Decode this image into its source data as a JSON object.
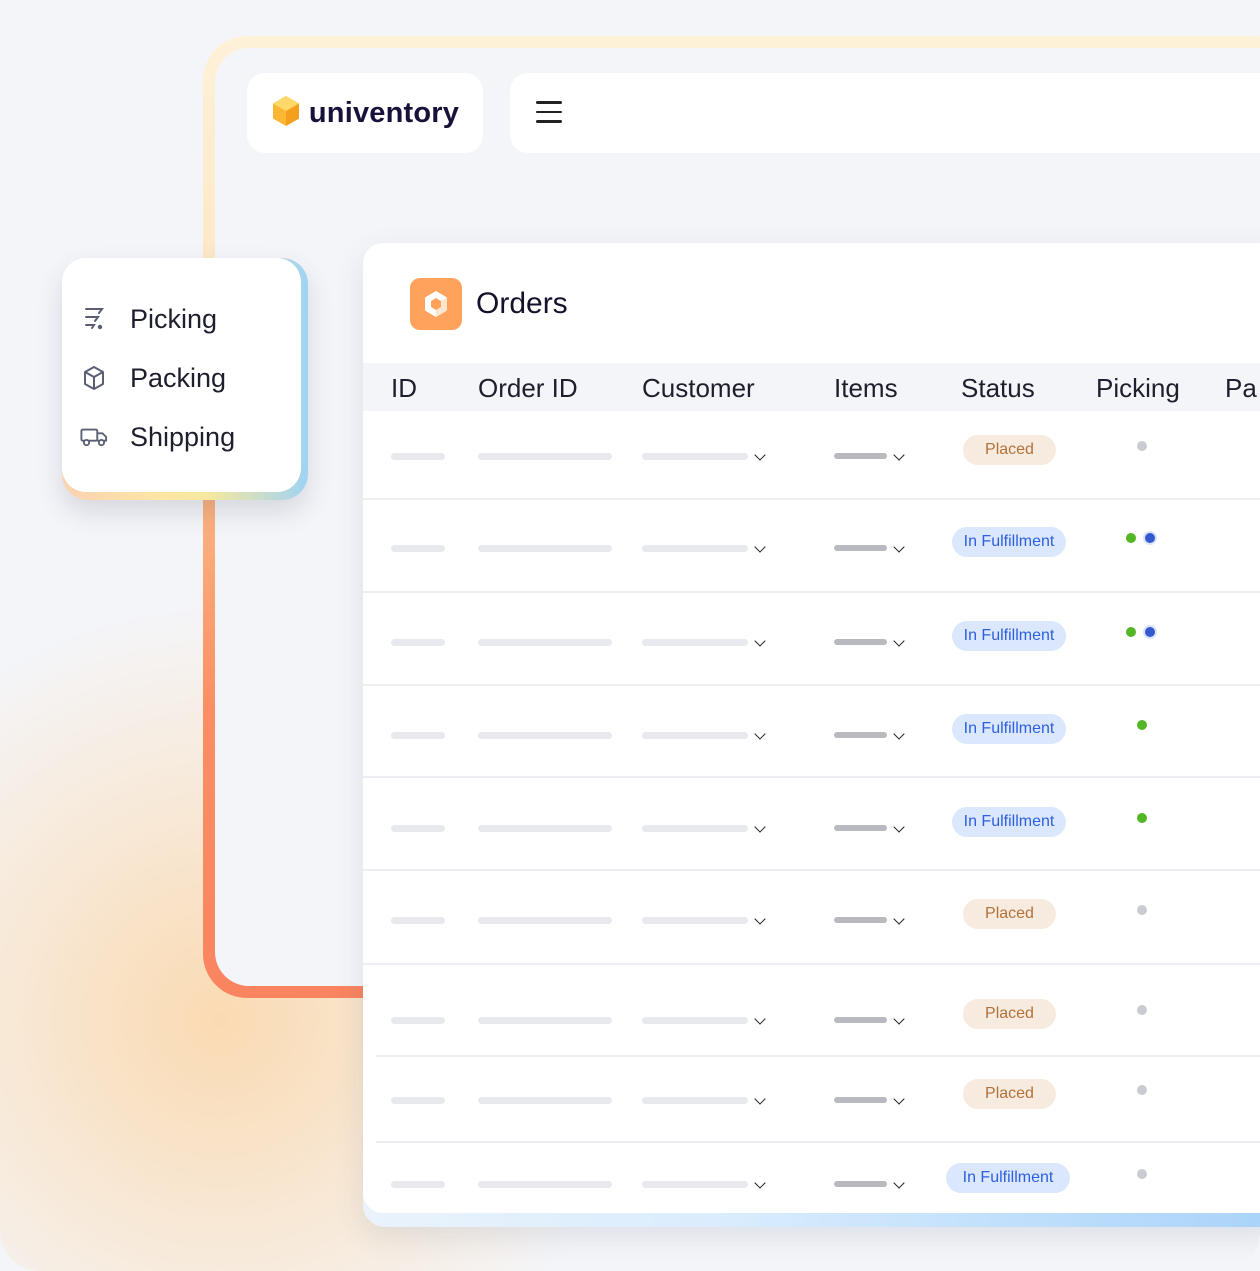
{
  "brand": {
    "name": "univentory"
  },
  "nav": {
    "items": [
      {
        "label": "Picking",
        "icon": "picking-icon"
      },
      {
        "label": "Packing",
        "icon": "box-icon"
      },
      {
        "label": "Shipping",
        "icon": "truck-icon"
      }
    ]
  },
  "orders": {
    "title": "Orders",
    "columns": [
      "ID",
      "Order ID",
      "Customer",
      "Items",
      "Status",
      "Picking",
      "Pa"
    ],
    "rows": [
      {
        "status": "Placed",
        "picking": [
          "gray"
        ]
      },
      {
        "status": "In Fulfillment",
        "picking": [
          "green",
          "blue"
        ]
      },
      {
        "status": "In Fulfillment",
        "picking": [
          "green",
          "blue"
        ]
      },
      {
        "status": "In Fulfillment",
        "picking": [
          "green"
        ]
      },
      {
        "status": "In Fulfillment",
        "picking": [
          "green"
        ]
      },
      {
        "status": "Placed",
        "picking": [
          "gray"
        ]
      },
      {
        "status": "Placed",
        "picking": [
          "gray"
        ]
      },
      {
        "status": "Placed",
        "picking": [
          "gray"
        ]
      },
      {
        "status": "In Fulfillment",
        "picking": [
          "gray"
        ]
      }
    ]
  },
  "colors": {
    "accent_orange": "#ffa35c",
    "placed_text": "#b0723a",
    "fulfillment_text": "#2d5fe0",
    "dot_green": "#53b625",
    "dot_blue": "#3459cf",
    "dot_gray": "#cbccd1"
  }
}
